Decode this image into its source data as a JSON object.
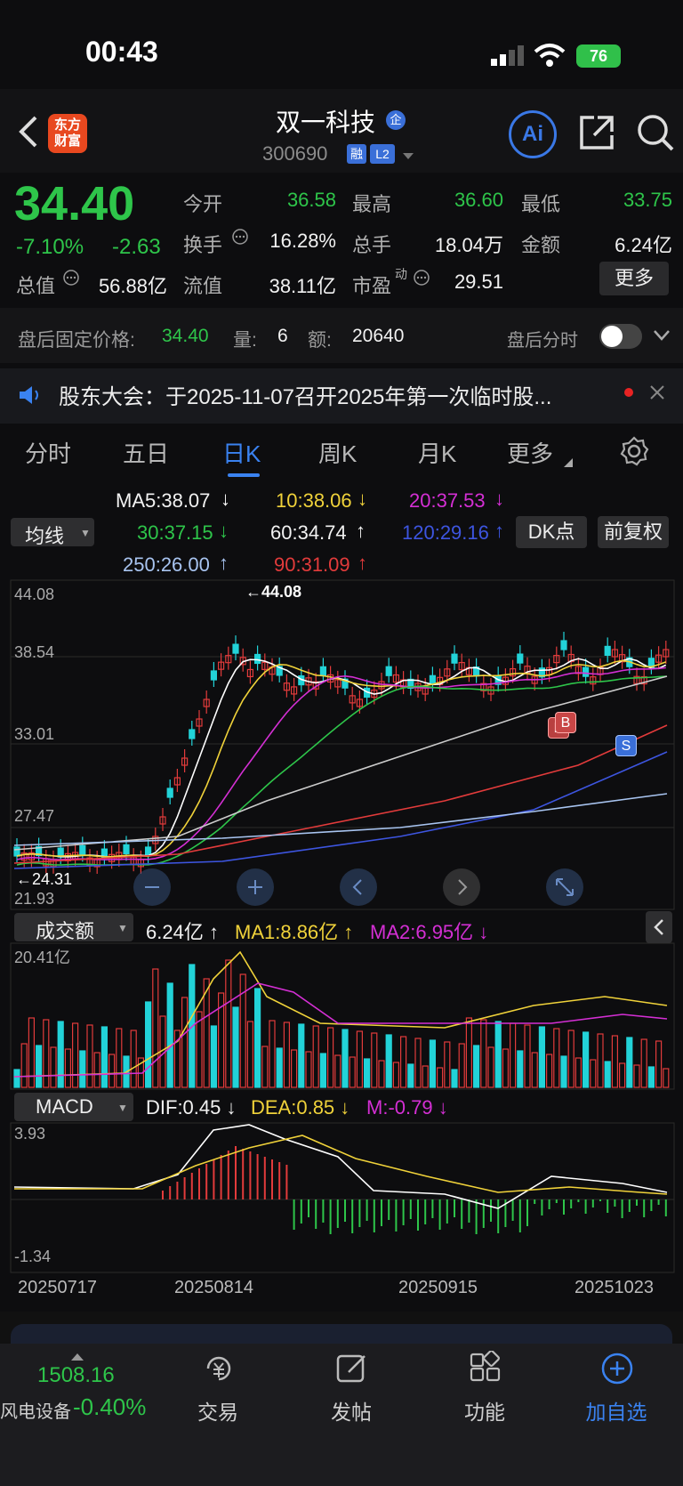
{
  "status": {
    "time": "00:43",
    "battery": "76"
  },
  "header": {
    "logo_line1": "东方",
    "logo_line2": "财富",
    "name": "双一科技",
    "badge": "企",
    "code": "300690",
    "tag_rong": "融",
    "tag_l2": "L2",
    "ai_label": "Ai"
  },
  "quote": {
    "price": "34.40",
    "change_pct": "-7.10%",
    "change": "-2.63",
    "open_label": "今开",
    "open": "36.58",
    "high_label": "最高",
    "high": "36.60",
    "low_label": "最低",
    "low": "33.75",
    "turnover_label": "换手",
    "turnover": "16.28%",
    "volume_label": "总手",
    "volume": "18.04万",
    "amount_label": "金额",
    "amount": "6.24亿",
    "mktcap_label": "总值",
    "mktcap": "56.88亿",
    "float_label": "流值",
    "float": "38.11亿",
    "pe_label": "市盈",
    "pe_sup": "动",
    "pe": "29.51",
    "more": "更多"
  },
  "after_hours": {
    "label": "盘后固定价格:",
    "price": "34.40",
    "vol_label": "量:",
    "vol": "6",
    "amt_label": "额:",
    "amt": "20640",
    "toggle_label": "盘后分时"
  },
  "notice": {
    "text": "股东大会：于2025-11-07召开2025年第一次临时股..."
  },
  "tabs": [
    "分时",
    "五日",
    "日K",
    "周K",
    "月K",
    "更多"
  ],
  "ma_legend": {
    "selector": "均线",
    "ma5": "MA5:38.07",
    "ma10": "10:38.06",
    "ma20": "20:37.53",
    "ma30": "30:37.15",
    "ma60": "60:34.74",
    "ma120": "120:29.16",
    "ma250": "250:26.00",
    "ma90": "90:31.09",
    "dk": "DK点",
    "fq": "前复权"
  },
  "colors": {
    "up": "#e23b3b",
    "down": "#22d3d8",
    "green": "#2ec54a",
    "accent": "#3a82f0"
  },
  "chart_data": {
    "type": "candlestick",
    "price_axis": {
      "ticks": [
        "44.08",
        "38.54",
        "33.01",
        "27.47",
        "21.93"
      ],
      "range": [
        21.93,
        44.08
      ]
    },
    "max_label": "44.08",
    "min_label": "24.31",
    "markers": [
      "B",
      "B",
      "S"
    ],
    "volume": {
      "selector": "成交额",
      "value": "6.24亿",
      "ma1": "MA1:8.86亿",
      "ma2": "MA2:6.95亿",
      "axis_max": "20.41亿"
    },
    "macd": {
      "selector": "MACD",
      "dif": "DIF:0.45",
      "dea": "DEA:0.85",
      "m": "M:-0.79",
      "axis_max": "3.93",
      "axis_min": "-1.34"
    },
    "dates": [
      "20250717",
      "20250814",
      "20250915",
      "20251023"
    ]
  },
  "bottom_nav": {
    "index_value": "1508.16",
    "index_name": "风电设备",
    "index_change": "-0.40%",
    "items": [
      "交易",
      "发帖",
      "功能",
      "加自选"
    ]
  }
}
